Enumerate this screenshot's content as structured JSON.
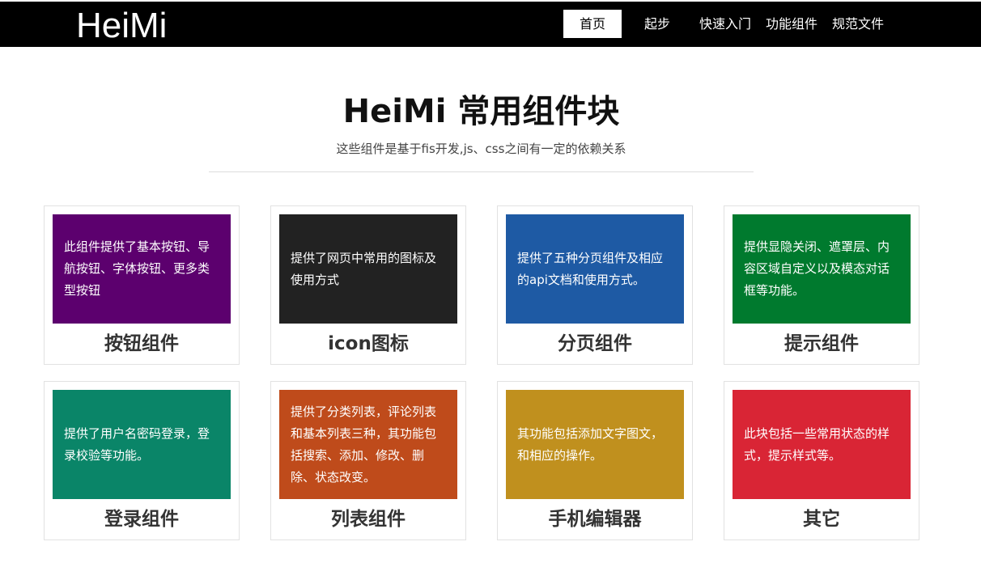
{
  "header": {
    "brand": "HeiMi",
    "nav": [
      {
        "label": "首页",
        "active": true
      },
      {
        "label": "起步",
        "active": false
      },
      {
        "label": "快速入门",
        "active": false
      },
      {
        "label": "功能组件",
        "active": false
      },
      {
        "label": "规范文件",
        "active": false
      }
    ]
  },
  "hero": {
    "title": "HeiMi 常用组件块",
    "subtitle": "这些组件是基于fis开发,js、css之间有一定的依赖关系"
  },
  "cards": [
    {
      "name": "按钮组件",
      "description": "此组件提供了基本按钮、导航按钮、字体按钮、更多类型按钮",
      "color": "#5c006e"
    },
    {
      "name": "icon图标",
      "description": "提供了网页中常用的图标及使用方式",
      "color": "#222222"
    },
    {
      "name": "分页组件",
      "description": "提供了五种分页组件及相应的api文档和使用方式。",
      "color": "#1e5aa4"
    },
    {
      "name": "提示组件",
      "description": "提供显隐关闭、遮罩层、内容区域自定义以及模态对话框等功能。",
      "color": "#007a2e"
    },
    {
      "name": "登录组件",
      "description": "提供了用户名密码登录，登录校验等功能。",
      "color": "#0a8568"
    },
    {
      "name": "列表组件",
      "description": "提供了分类列表，评论列表和基本列表三种，其功能包括搜索、添加、修改、删除、状态改变。",
      "color": "#bf4b1b"
    },
    {
      "name": "手机编辑器",
      "description": "其功能包括添加文字图文，和相应的操作。",
      "color": "#c0901e"
    },
    {
      "name": "其它",
      "description": "此块包括一些常用状态的样式，提示样式等。",
      "color": "#d92535"
    }
  ]
}
